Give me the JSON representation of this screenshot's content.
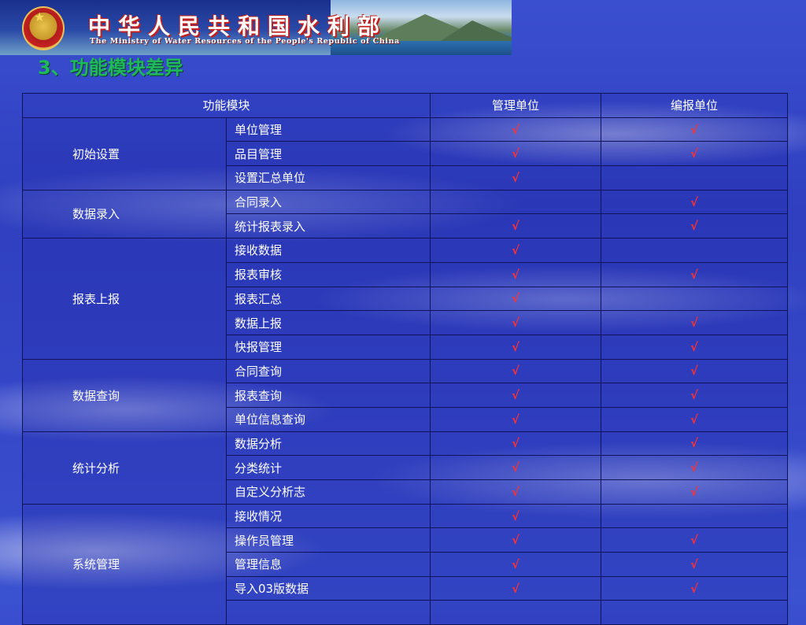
{
  "banner": {
    "title_cn": "中华人民共和国水利部",
    "title_en": "The Ministry of Water Resources of the People's Republic of China"
  },
  "slide": {
    "title": "3、功能模块差异"
  },
  "table": {
    "headers": {
      "module": "功能模块",
      "manager": "管理单位",
      "reporter": "编报单位"
    },
    "check_mark": "√",
    "groups": [
      {
        "name": "初始设置",
        "rows": [
          {
            "item": "单位管理",
            "manager": "√",
            "reporter": "√"
          },
          {
            "item": "品目管理",
            "manager": "√",
            "reporter": "√"
          },
          {
            "item": "设置汇总单位",
            "manager": "√",
            "reporter": ""
          }
        ]
      },
      {
        "name": "数据录入",
        "rows": [
          {
            "item": "合同录入",
            "manager": "",
            "reporter": "√"
          },
          {
            "item": "统计报表录入",
            "manager": "√",
            "reporter": "√"
          }
        ]
      },
      {
        "name": "报表上报",
        "rows": [
          {
            "item": "接收数据",
            "manager": "√",
            "reporter": ""
          },
          {
            "item": "报表审核",
            "manager": "√",
            "reporter": "√"
          },
          {
            "item": "报表汇总",
            "manager": "√",
            "reporter": ""
          },
          {
            "item": "数据上报",
            "manager": "√",
            "reporter": "√"
          },
          {
            "item": "快报管理",
            "manager": "√",
            "reporter": "√"
          }
        ]
      },
      {
        "name": "数据查询",
        "rows": [
          {
            "item": "合同查询",
            "manager": "√",
            "reporter": "√"
          },
          {
            "item": "报表查询",
            "manager": "√",
            "reporter": "√"
          },
          {
            "item": "单位信息查询",
            "manager": "√",
            "reporter": "√"
          }
        ]
      },
      {
        "name": "统计分析",
        "rows": [
          {
            "item": "数据分析",
            "manager": "√",
            "reporter": "√"
          },
          {
            "item": "分类统计",
            "manager": "√",
            "reporter": "√"
          },
          {
            "item": "自定义分析志",
            "manager": "√",
            "reporter": "√"
          }
        ]
      },
      {
        "name": "系统管理",
        "rows": [
          {
            "item": "接收情况",
            "manager": "√",
            "reporter": ""
          },
          {
            "item": "操作员管理",
            "manager": "√",
            "reporter": "√"
          },
          {
            "item": "管理信息",
            "manager": "√",
            "reporter": "√"
          },
          {
            "item": "导入03版数据",
            "manager": "√",
            "reporter": "√"
          },
          {
            "item": "",
            "manager": "",
            "reporter": ""
          }
        ]
      }
    ]
  },
  "colors": {
    "title": "#1fb85a",
    "check": "#ff3030",
    "background": "#3445c6",
    "banner_red": "#c21f1f"
  },
  "icons": {
    "emblem": "national-emblem-icon"
  }
}
